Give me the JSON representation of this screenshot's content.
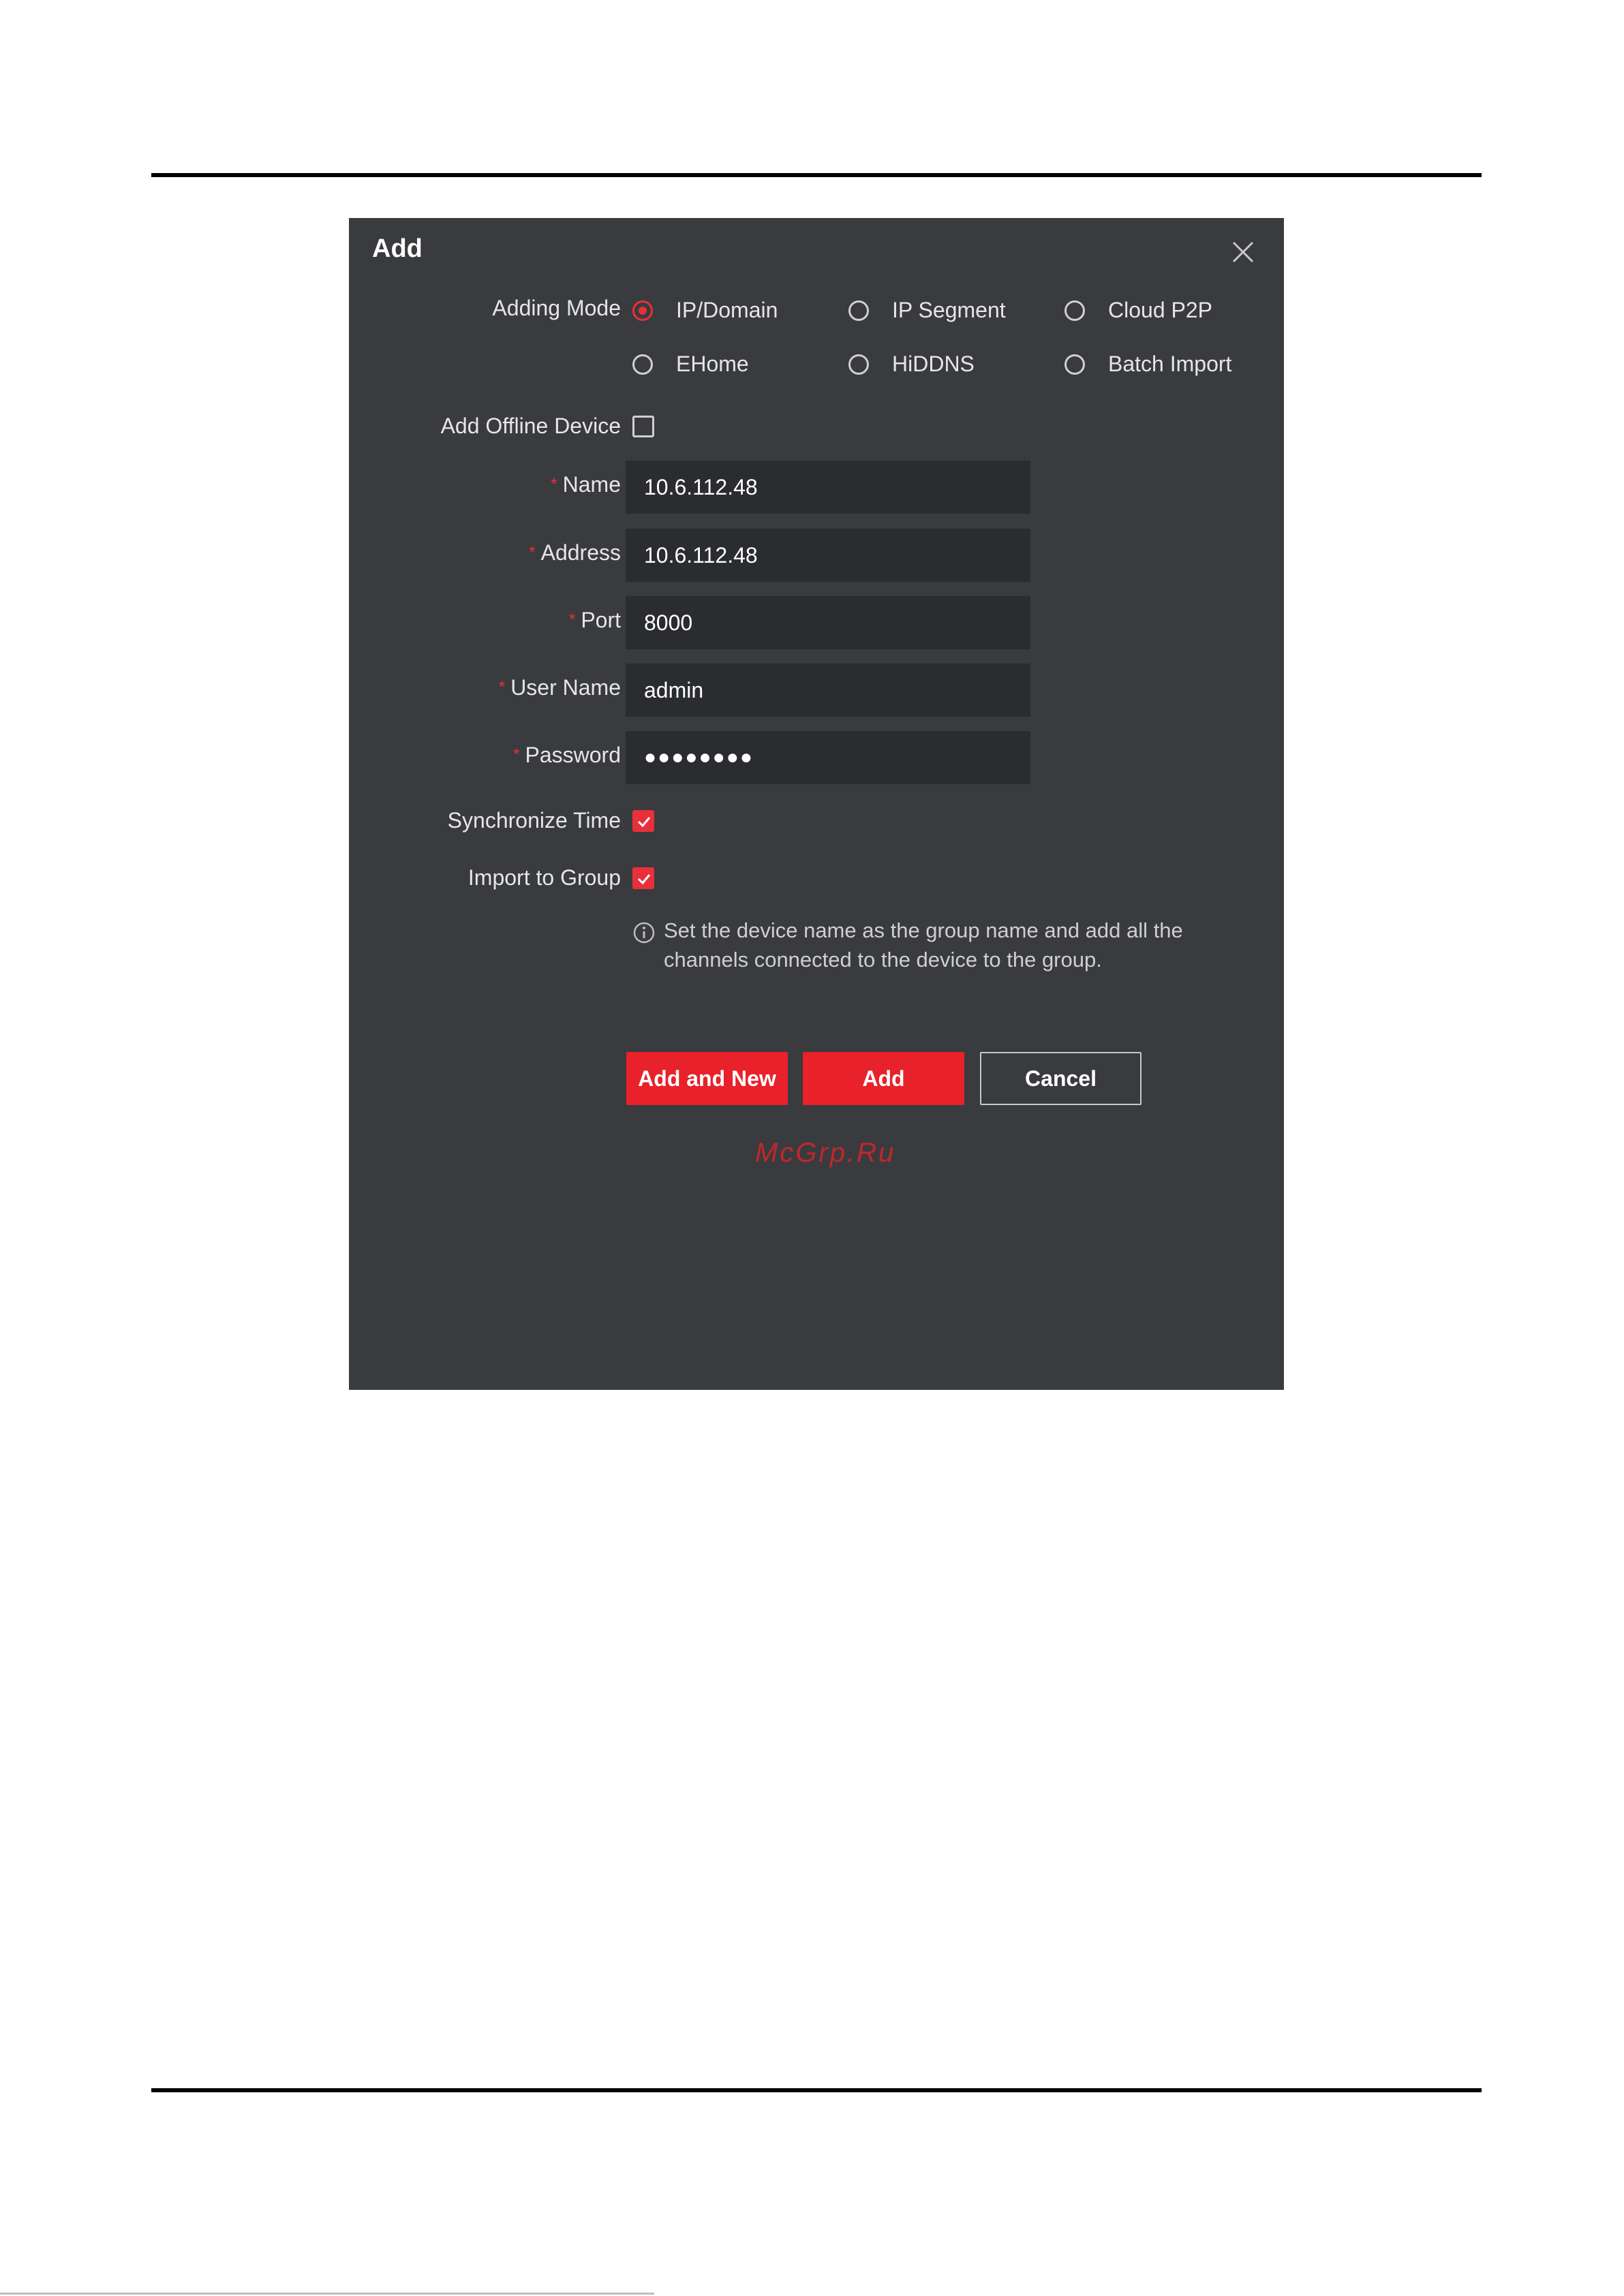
{
  "dialog": {
    "title": "Add",
    "adding_mode": {
      "label": "Adding Mode",
      "options": [
        {
          "label": "IP/Domain",
          "selected": true
        },
        {
          "label": "IP Segment",
          "selected": false
        },
        {
          "label": "Cloud P2P",
          "selected": false
        },
        {
          "label": "EHome",
          "selected": false
        },
        {
          "label": "HiDDNS",
          "selected": false
        },
        {
          "label": "Batch Import",
          "selected": false
        }
      ]
    },
    "add_offline_device": {
      "label": "Add Offline Device",
      "checked": false
    },
    "fields": {
      "name": {
        "label": "Name",
        "value": "10.6.112.48",
        "required": "*"
      },
      "address": {
        "label": "Address",
        "value": "10.6.112.48",
        "required": "*"
      },
      "port": {
        "label": "Port",
        "value": "8000",
        "required": "*"
      },
      "user_name": {
        "label": "User Name",
        "value": "admin",
        "required": "*"
      },
      "password": {
        "label": "Password",
        "value": "●●●●●●●●",
        "required": "*"
      }
    },
    "synchronize_time": {
      "label": "Synchronize Time",
      "checked": true
    },
    "import_to_group": {
      "label": "Import to Group",
      "checked": true
    },
    "hint": "Set the device name as the group name and add all the channels connected to the device to the group.",
    "buttons": {
      "add_and_new": "Add and New",
      "add": "Add",
      "cancel": "Cancel"
    },
    "watermark": "McGrp.Ru"
  },
  "colors": {
    "dialog_bg": "#3a3b3e",
    "input_bg": "#2b2c30",
    "accent": "#e8212b",
    "text": "#e6e6e6"
  }
}
